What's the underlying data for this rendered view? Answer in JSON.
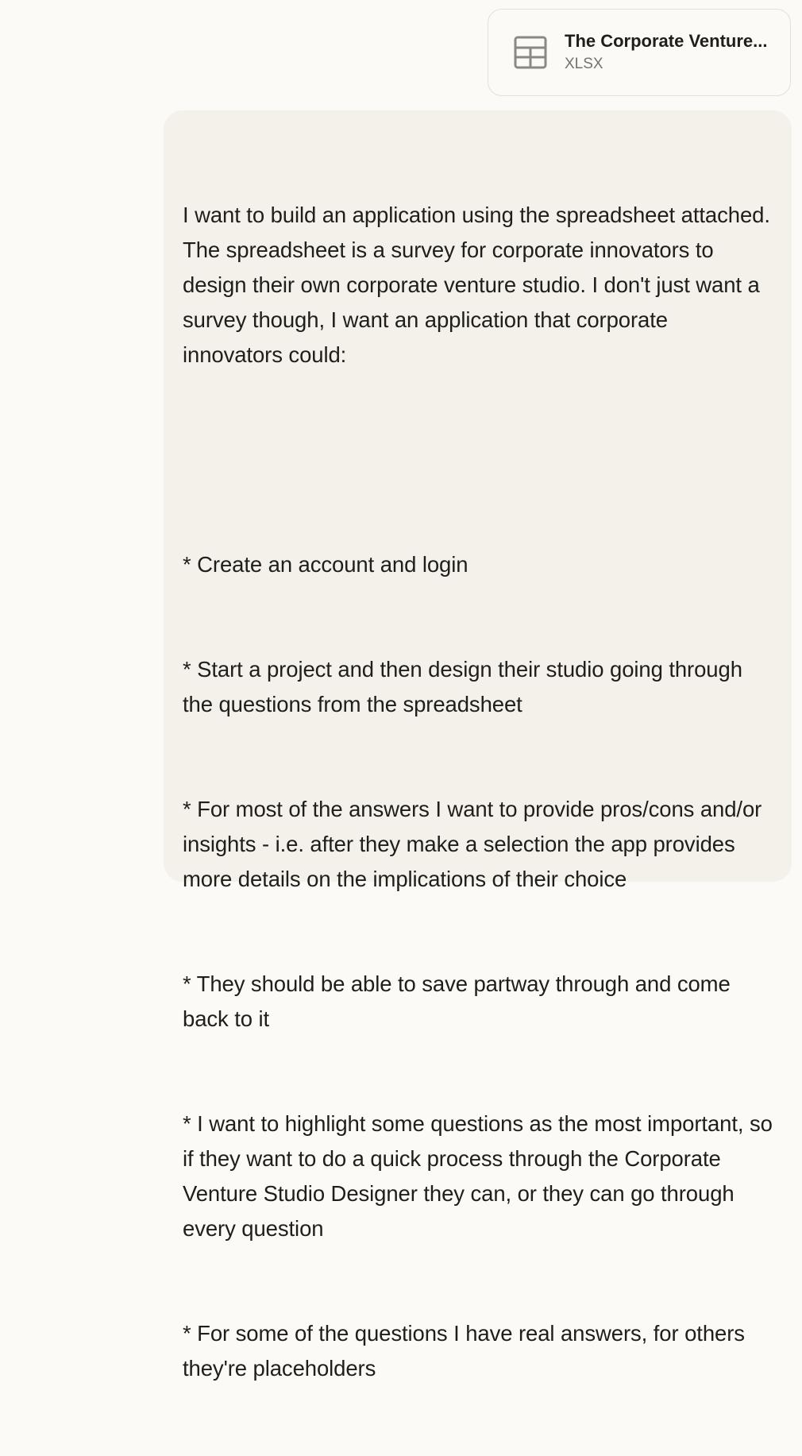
{
  "attachment": {
    "icon": "spreadsheet-table-icon",
    "filename": "The Corporate Venture...",
    "filetype": "XLSX"
  },
  "message": {
    "intro": "I want to build an application using the spreadsheet attached. The spreadsheet is a survey for corporate innovators to design their own corporate venture studio. I don't just want a survey though, I want an application that corporate innovators could:",
    "bullets": [
      "* Create an account and login",
      "* Start a project and then design their studio going through the questions from the spreadsheet",
      "* For most of the answers I want to provide pros/cons and/or insights - i.e. after they make a selection the app provides more details on the implications of their choice",
      "* They should be able to save partway through and come back to it",
      "* I want to highlight some questions as the most important, so if they want to do a quick process through the Corporate Venture Studio Designer they can, or they can go through every question",
      "* For some of the questions I have real answers, for others they're placeholders"
    ]
  },
  "colors": {
    "page_background": "#fbfaf7",
    "bubble_background": "#f4f1eb",
    "card_border": "#e3e0d9",
    "text_primary": "#1f1e1b",
    "text_secondary": "#75736d",
    "icon_stroke": "#8a8883"
  }
}
